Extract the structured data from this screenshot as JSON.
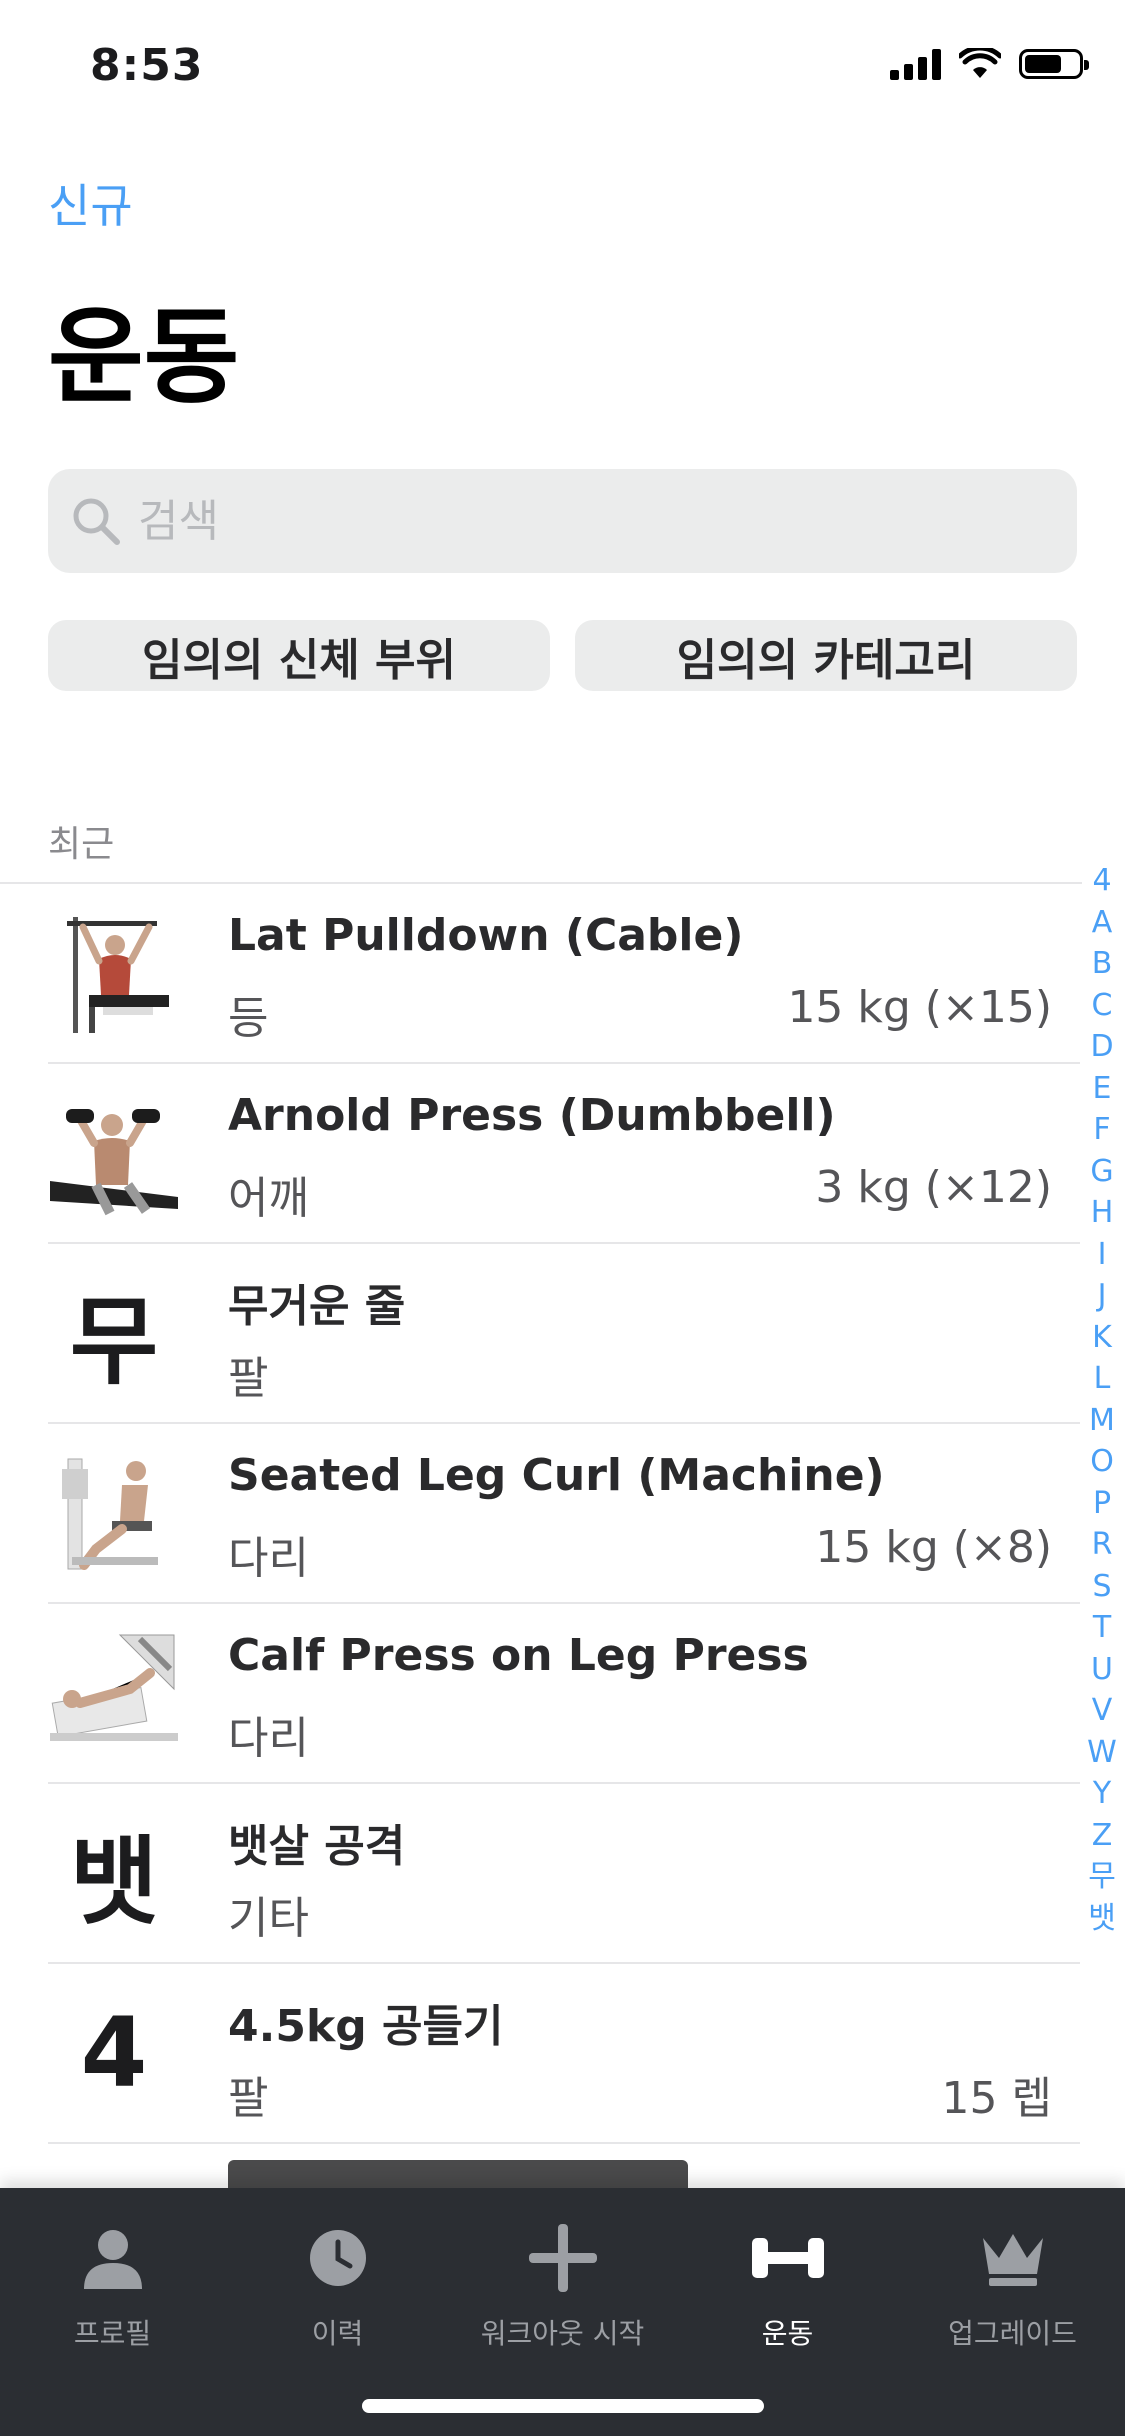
{
  "status_bar": {
    "time": "8:53"
  },
  "nav": {
    "new_label": "신규"
  },
  "page": {
    "title": "운동"
  },
  "search": {
    "placeholder": "검색"
  },
  "filters": {
    "body_part": "임의의 신체 부위",
    "category": "임의의 카테고리"
  },
  "section": {
    "recent_label": "최근"
  },
  "exercises": [
    {
      "name": "Lat Pulldown (Cable)",
      "category": "등",
      "stat": "15 kg (×15)",
      "thumb": "lat-pulldown-illustration"
    },
    {
      "name": "Arnold Press (Dumbbell)",
      "category": "어깨",
      "stat": "3 kg (×12)",
      "thumb": "arnold-press-illustration"
    },
    {
      "name": "무거운 줄",
      "category": "팔",
      "stat": "",
      "letter": "무"
    },
    {
      "name": "Seated Leg Curl (Machine)",
      "category": "다리",
      "stat": "15 kg (×8)",
      "thumb": "leg-curl-illustration"
    },
    {
      "name": "Calf Press on Leg Press",
      "category": "다리",
      "stat": "",
      "thumb": "calf-press-illustration"
    },
    {
      "name": "뱃살 공격",
      "category": "기타",
      "stat": "",
      "letter": "뱃"
    },
    {
      "name": "4.5kg 공들기",
      "category": "팔",
      "stat": "15 렙",
      "letter": "4"
    }
  ],
  "index_letters": [
    "4",
    "A",
    "B",
    "C",
    "D",
    "E",
    "F",
    "G",
    "H",
    "I",
    "J",
    "K",
    "L",
    "M",
    "O",
    "P",
    "R",
    "S",
    "T",
    "U",
    "V",
    "W",
    "Y",
    "Z",
    "무",
    "뱃"
  ],
  "tabs": [
    {
      "label": "프로필",
      "icon": "person-icon"
    },
    {
      "label": "이력",
      "icon": "clock-icon"
    },
    {
      "label": "워크아웃 시작",
      "icon": "plus-icon"
    },
    {
      "label": "운동",
      "icon": "dumbbell-icon",
      "active": true
    },
    {
      "label": "업그레이드",
      "icon": "crown-icon"
    }
  ],
  "colors": {
    "accent": "#4a9ff5",
    "tabbar": "#2b2e33",
    "field": "#ebecec"
  }
}
